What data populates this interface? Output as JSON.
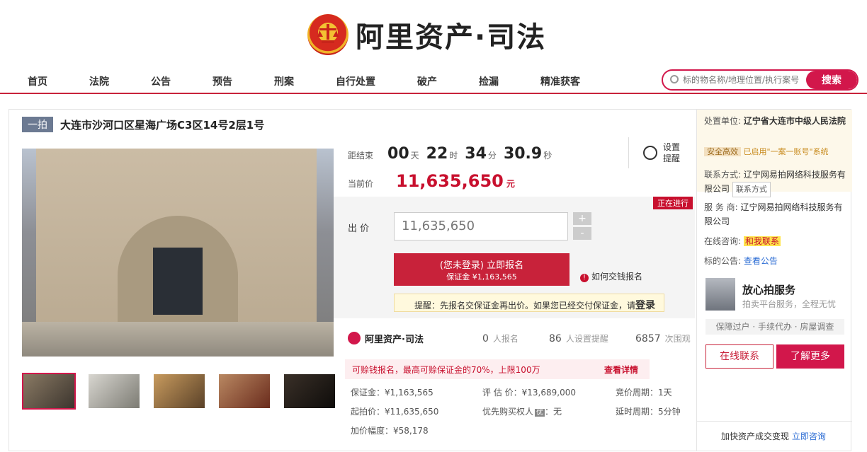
{
  "brand": {
    "name": "阿里资产·司法"
  },
  "nav": [
    "首页",
    "法院",
    "公告",
    "预告",
    "刑案",
    "自行处置",
    "破产",
    "捡漏",
    "精准获客"
  ],
  "search": {
    "placeholder": "标的物名称/地理位置/执行案号",
    "button": "搜索"
  },
  "item": {
    "round_badge": "一拍",
    "title": "大连市沙河口区星海广场C3区14号2层1号"
  },
  "countdown": {
    "label": "距结束",
    "days": "00",
    "days_unit": "天",
    "hours": "22",
    "hours_unit": "时",
    "minutes": "34",
    "minutes_unit": "分",
    "seconds": "30.9",
    "seconds_unit": "秒"
  },
  "reminder": {
    "label": "设置提醒"
  },
  "current_price": {
    "label": "当前价",
    "value": "11,635,650",
    "unit": "元"
  },
  "status": "正在进行",
  "bid": {
    "label": "出 价",
    "value": "11,635,650",
    "plus": "+",
    "minus": "-",
    "signup_main": "(您未登录) 立即报名",
    "signup_sub": "保证金 ¥1,163,565",
    "how_to_pay": "如何交钱报名",
    "tip_text": "提醒：先报名交保证金再出价。如果您已经交付保证金，请",
    "tip_login": "登录"
  },
  "stats": {
    "brand": "阿里资产·司法",
    "applicants": "0",
    "applicants_label": "人报名",
    "reminders": "86",
    "reminders_label": "人设置提醒",
    "views": "6857",
    "views_label": "次围观"
  },
  "promo": {
    "text": "可赊钱报名，最高可赊保证金的70%，上限100万",
    "link": "查看详情"
  },
  "details": {
    "deposit": "保证金：¥1,163,565",
    "appraisal": "评 估 价：¥13,689,000",
    "bid_cycle": "竞价周期：1天",
    "start_price": "起拍价：¥11,635,650",
    "priority": "优先购买权人",
    "priority_badge": "优",
    "priority_value": "：无",
    "extension": "延时周期：5分钟",
    "increment": "加价幅度：¥58,178"
  },
  "right": {
    "dispose_label": "处置单位:",
    "dispose_value": "辽宁省大连市中级人民法院",
    "security_badge": "安全高效",
    "security_text": "已启用\"一案一账号\"系统",
    "contact_label": "联系方式:",
    "contact_value": "辽宁网易拍网络科技服务有限公司",
    "contact_btn": "联系方式",
    "provider_label": "服 务 商:",
    "provider_value": "辽宁网易拍网络科技服务有限公司",
    "online_label": "在线咨询:",
    "online_value": "和我联系",
    "notice_label": "标的公告:",
    "notice_value": "查看公告",
    "service_title": "放心拍服务",
    "service_sub": "拍卖平台服务，全程无忧",
    "service_tags": "保障过户 · 手续代办 · 房屋调查",
    "btn_online": "在线联系",
    "btn_more": "了解更多",
    "consult_text": "加快资产成交变现",
    "consult_link": "立即咨询"
  }
}
